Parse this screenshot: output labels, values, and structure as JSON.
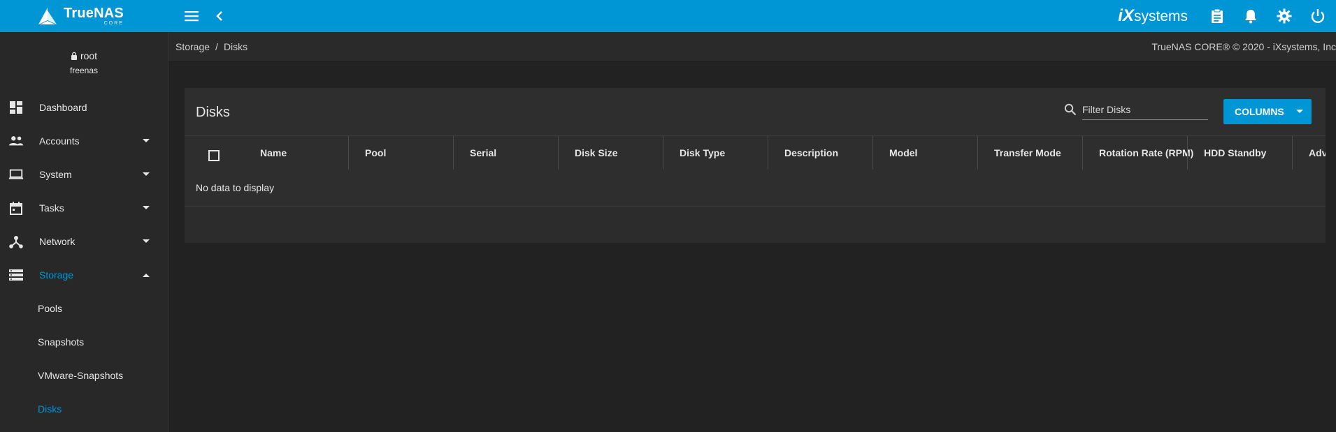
{
  "app": {
    "logo_title": "TrueNAS",
    "logo_sub": "CORE",
    "vendor_i": "iX",
    "vendor_rest": "systems",
    "colors": {
      "topbar": "#0095d5",
      "accent": "#0095d5",
      "background": "#222222",
      "sidebar": "#282828",
      "card": "#2e2e2e"
    }
  },
  "topbar": {
    "icons": [
      "menu-icon",
      "back-chevron-icon",
      "clipboard-icon",
      "bell-icon",
      "gear-icon",
      "power-icon"
    ]
  },
  "user": {
    "name": "root",
    "host": "freenas"
  },
  "sidebar": {
    "items": [
      {
        "label": "Dashboard",
        "icon": "dashboard-icon"
      },
      {
        "label": "Accounts",
        "icon": "people-icon"
      },
      {
        "label": "System",
        "icon": "laptop-icon"
      },
      {
        "label": "Tasks",
        "icon": "calendar-icon"
      },
      {
        "label": "Network",
        "icon": "network-icon"
      },
      {
        "label": "Storage",
        "icon": "storage-icon"
      }
    ],
    "storage_sub": [
      "Pools",
      "Snapshots",
      "VMware-Snapshots",
      "Disks"
    ]
  },
  "breadcrumb": {
    "parent": "Storage",
    "sep": "/",
    "current": "Disks"
  },
  "copyright": "TrueNAS CORE® © 2020 - iXsystems, Inc",
  "card": {
    "title": "Disks",
    "filter_placeholder": "Filter Disks",
    "columns_button": "COLUMNS",
    "columns": [
      "Name",
      "Pool",
      "Serial",
      "Disk Size",
      "Disk Type",
      "Description",
      "Model",
      "Transfer Mode",
      "Rotation Rate (RPM)",
      "HDD Standby",
      "Adv"
    ],
    "empty_message": "No data to display"
  }
}
